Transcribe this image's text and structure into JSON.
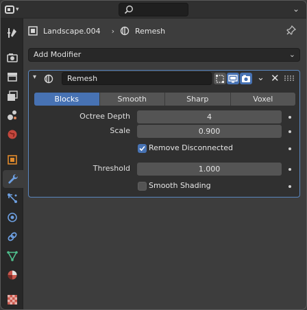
{
  "breadcrumb": {
    "object_name": "Landscape.004",
    "modifier_name": "Remesh"
  },
  "add_modifier": {
    "label": "Add Modifier"
  },
  "modifier": {
    "name": "Remesh",
    "modes": [
      "Blocks",
      "Smooth",
      "Sharp",
      "Voxel"
    ],
    "active_mode": "Blocks",
    "fields": {
      "octree_depth": {
        "label": "Octree Depth",
        "value": "4"
      },
      "scale": {
        "label": "Scale",
        "value": "0.900"
      },
      "remove_disconnected": {
        "label": "Remove Disconnected",
        "checked": true
      },
      "threshold": {
        "label": "Threshold",
        "value": "1.000"
      },
      "smooth_shading": {
        "label": "Smooth Shading",
        "checked": false
      }
    }
  },
  "tabs": [
    "tool-icon",
    "render-icon",
    "output-icon",
    "view-layer-icon",
    "scene-icon",
    "world-icon",
    "object-icon",
    "modifier-icon",
    "particles-icon",
    "physics-icon",
    "constraints-icon",
    "data-icon",
    "material-icon",
    "texture-icon"
  ],
  "colors": {
    "accent": "#4772b3",
    "panel": "#303030",
    "background": "#3d3d3d"
  }
}
